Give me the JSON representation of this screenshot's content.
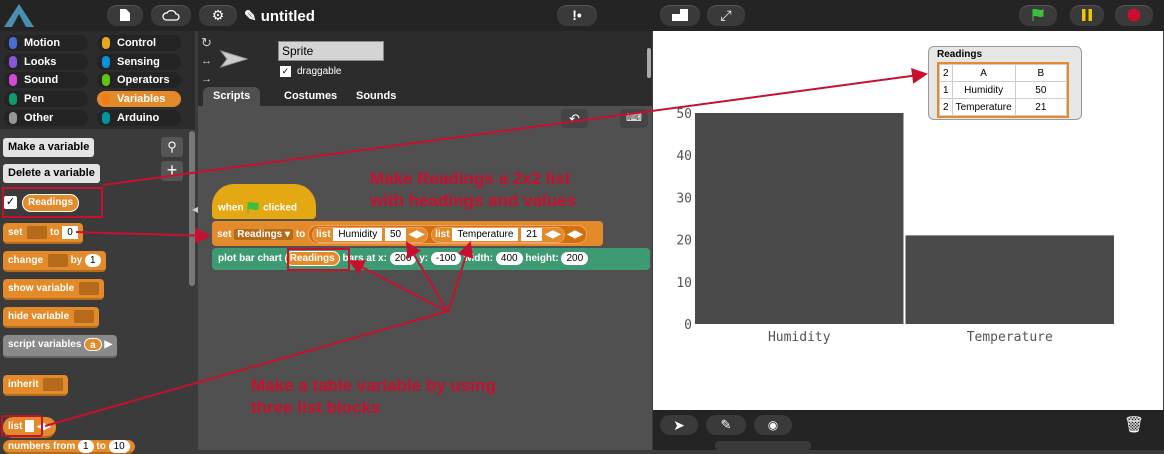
{
  "topbar": {
    "title": "✎ untitled"
  },
  "categories": [
    {
      "label": "Motion",
      "color": "#4a6cd4",
      "selected": false
    },
    {
      "label": "Control",
      "color": "#e6a822",
      "selected": false
    },
    {
      "label": "Looks",
      "color": "#8a55d7",
      "selected": false
    },
    {
      "label": "Sensing",
      "color": "#0494dc",
      "selected": false
    },
    {
      "label": "Sound",
      "color": "#cf4ad9",
      "selected": false
    },
    {
      "label": "Operators",
      "color": "#62c213",
      "selected": false
    },
    {
      "label": "Pen",
      "color": "#0e9a6c",
      "selected": false
    },
    {
      "label": "Variables",
      "color": "#ee7d16",
      "selected": true
    },
    {
      "label": "Other",
      "color": "#969696",
      "selected": false
    },
    {
      "label": "Arduino",
      "color": "#00979c",
      "selected": false
    }
  ],
  "palette": {
    "make_variable": "Make a variable",
    "delete_variable": "Delete a variable",
    "readings_var": "Readings",
    "set_label": "set",
    "set_to": "to",
    "set_value": "0",
    "change_label": "change",
    "change_by": "by",
    "change_value": "1",
    "show_variable": "show variable",
    "hide_variable": "hide variable",
    "script_variables": "script variables",
    "script_var_arg": "a",
    "inherit": "inherit",
    "list": "list",
    "numbers_from": "numbers from",
    "numbers_from_value": "1",
    "numbers_to": "to",
    "numbers_to_value": "10"
  },
  "sprite": {
    "name": "Sprite",
    "draggable": "draggable"
  },
  "tabs": [
    "Scripts",
    "Costumes",
    "Sounds"
  ],
  "script": {
    "when": "when",
    "clicked": "clicked",
    "set": "set",
    "var": "Readings",
    "to": "to",
    "list": "list",
    "humidity": "Humidity",
    "hv": "50",
    "temperature": "Temperature",
    "tv": "21",
    "plot_bar": "plot bar chart",
    "readings": "Readings",
    "bars_at_x": "bars at x:",
    "x_val": "200",
    "y": "y:",
    "y_val": "-100",
    "width": "width:",
    "w_val": "400",
    "height": "height:",
    "h_val": "200"
  },
  "annotations": {
    "a1_l1": "Make Readings a 2x2 list",
    "a1_l2": "with headings and values",
    "a2_l1": "Make a table variable by using",
    "a2_l2": "three list blocks"
  },
  "watcher": {
    "title": "Readings",
    "corner": "2",
    "colA": "A",
    "colB": "B",
    "rows": [
      {
        "idx": "1",
        "a": "Humidity",
        "b": "50"
      },
      {
        "idx": "2",
        "a": "Temperature",
        "b": "21"
      }
    ]
  },
  "chart_data": {
    "type": "bar",
    "categories": [
      "Humidity",
      "Temperature"
    ],
    "values": [
      50,
      21
    ],
    "ylim": [
      0,
      50
    ],
    "yticks": [
      "0",
      "10",
      "20",
      "30",
      "40",
      "50"
    ],
    "bar_color": "#4a4a4a"
  }
}
